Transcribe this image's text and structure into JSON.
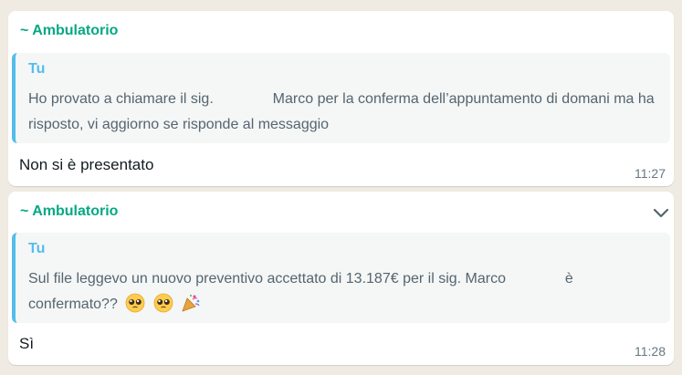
{
  "messages": [
    {
      "sender": "~ Ambulatorio",
      "quote": {
        "author": "Tu",
        "text_before": "Ho provato a chiamare il sig.",
        "text_after": "Marco per la conferma dell’appuntamento di domani ma ha risposto, vi aggiorno se risponde al messaggio"
      },
      "text": "Non si è presentato",
      "time": "11:27"
    },
    {
      "sender": "~ Ambulatorio",
      "quote": {
        "author": "Tu",
        "text_before": "Sul file leggevo un nuovo preventivo accettato di 13.187€ per il sig. Marco",
        "text_after": "è confermato??",
        "emojis": [
          "pleading-face-emoji",
          "pleading-face-emoji",
          "party-popper-emoji"
        ]
      },
      "text": "Sì",
      "time": "11:28",
      "menu_icon": "chevron-down-icon"
    }
  ],
  "colors": {
    "background": "#efeae2",
    "bubble": "#ffffff",
    "sender": "#06a884",
    "quote_accent": "#53bdeb",
    "quote_bg": "#f5f6f6"
  }
}
